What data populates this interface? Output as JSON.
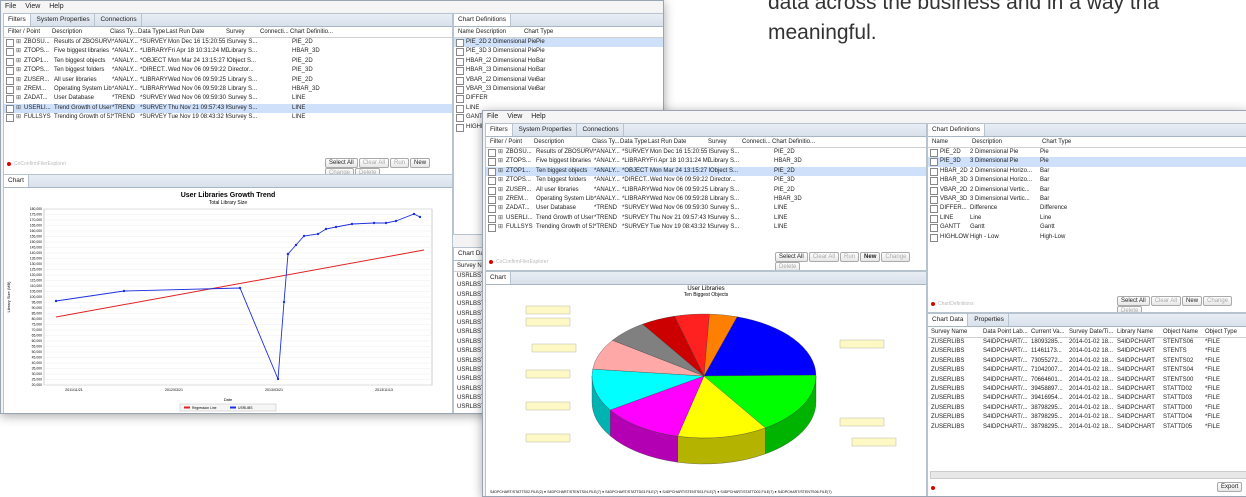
{
  "page_text": {
    "line1": "data across the business and in a way tha",
    "line2": "meaningful."
  },
  "colors": {
    "accent": "#3a6fc7",
    "selection": "#cfe0fa",
    "status_red": "#d00000"
  },
  "back_window": {
    "menu": [
      "File",
      "View",
      "Help"
    ],
    "tabs": [
      "Filters",
      "System Properties",
      "Connections"
    ],
    "columns": [
      "Filter / Point",
      "Description",
      "Class Ty...",
      "Data Type",
      "Last Run Date",
      "Survey",
      "Connecti...",
      "Chart Definitio..."
    ],
    "rows": [
      [
        "ZBOSU...",
        "Results of ZBOSURVEY (...",
        "*ANALY...",
        "*SURVEY",
        "Mon Dec 16 15:20:55 M...",
        "Survey S...",
        "",
        "PIE_2D"
      ],
      [
        "ZTOPS...",
        "Five biggest libraries",
        "*ANALY...",
        "*LIBRARY",
        "Fri Apr 18 10:31:24 MD...",
        "Library S...",
        "",
        "HBAR_3D"
      ],
      [
        "ZTOP1...",
        "Ten biggest objects",
        "*ANALY...",
        "*OBJECT",
        "Mon Mar 24 13:15:27 M...",
        "Object S...",
        "",
        "PIE_2D"
      ],
      [
        "ZTOPS...",
        "Ten biggest folders",
        "*ANALY...",
        "*DIRECT...",
        "Wed Nov 06 09:59:22 M...",
        "Director...",
        "",
        "PIE_3D"
      ],
      [
        "ZUSER...",
        "All user libraries",
        "*ANALY...",
        "*LIBRARY",
        "Wed Nov 06 09:59:25 M...",
        "Library S...",
        "",
        "PIE_2D"
      ],
      [
        "ZREM...",
        "Operating System Libra...",
        "*ANALY...",
        "*LIBRARY",
        "Wed Nov 06 09:59:28 M...",
        "Library S...",
        "",
        "HBAR_3D"
      ],
      [
        "ZADAT...",
        "User Database",
        "*TREND",
        "*SURVEY",
        "Wed Nov 06 09:59:30 M...",
        "Survey S...",
        "",
        "LINE"
      ],
      [
        "USERLI...",
        "Trend Growth of User Li...",
        "*TREND",
        "*SURVEY",
        "Thu Nov 21 09:57:43 M...",
        "Survey S...",
        "",
        "LINE"
      ],
      [
        "FULLSYS",
        "Trending Growth of 515...",
        "*TREND",
        "*SURVEY",
        "Tue Nov 19 08:43:32 M...",
        "Survey S...",
        "",
        "LINE"
      ]
    ],
    "selected_row": 7,
    "buttons": [
      "Select All",
      "Clear All",
      "Run",
      "New",
      "Change",
      "Delete"
    ],
    "status_text": "CoConfirmFilerExplorer",
    "chart_tab": "Chart",
    "chart_defs_tab": "Chart Definitions",
    "chart_defs_columns": [
      "Name",
      "Description",
      "Chart Type"
    ],
    "chart_defs_rows": [
      [
        "PIE_2D",
        "2 Dimensional Pie",
        "Pie"
      ],
      [
        "PIE_3D",
        "3 Dimensional Pie",
        "Pie"
      ],
      [
        "HBAR_2D",
        "2 Dimensional Horizo...",
        "Bar"
      ],
      [
        "HBAR_3D",
        "3 Dimensional Horizo...",
        "Bar"
      ],
      [
        "VBAR_2D",
        "2 Dimensional Vertic...",
        "Bar"
      ],
      [
        "VBAR_3D",
        "3 Dimensional Vertic...",
        "Bar"
      ],
      [
        "DIFFER...",
        "",
        ""
      ],
      [
        "LINE",
        "",
        ""
      ],
      [
        "GANTT",
        "",
        ""
      ],
      [
        "HIGHLO",
        "",
        ""
      ]
    ],
    "chart_data_tab": "Chart Dat",
    "chart_data_col": "Survey Nam",
    "chart_data_rows": [
      "USRLBSTR",
      "USRLBSTR",
      "USRLBSTR",
      "USRLBSTR",
      "USRLBSTR",
      "USRLBSTR",
      "USRLBSTR",
      "USRLBSTR",
      "USRLBSTR",
      "USRLBSTR",
      "USRLBSTR",
      "USRLBSTR",
      "USRLBSTR",
      "USRLBSTR",
      "USRLBSTR",
      "USRLBSTR"
    ],
    "line_chart": {
      "title": "User Libraries Growth Trend",
      "subtitle": "Total Library Size",
      "xlabel": "Date",
      "ylabel": "Library Size (MB)",
      "y_ticks": [
        "180,000",
        "175,000",
        "170,000",
        "165,000",
        "160,000",
        "155,000",
        "150,000",
        "145,000",
        "140,000",
        "135,000",
        "130,000",
        "125,000",
        "120,000",
        "115,000",
        "110,000",
        "105,000",
        "100,000",
        "95,000",
        "90,000",
        "85,000",
        "80,000",
        "75,000",
        "70,000",
        "65,000",
        "60,000",
        "55,000",
        "50,000",
        "45,000",
        "40,000",
        "35,000",
        "30,000",
        "25,000",
        "20,000"
      ],
      "x_ticks": [
        "2011/11/21",
        "2012/03/21",
        "2013/03/21",
        "2013/11/13"
      ],
      "legend": [
        "Regression Line",
        "USRLIBS"
      ]
    }
  },
  "front_window": {
    "menu": [
      "File",
      "View",
      "Help"
    ],
    "tabs": [
      "Filters",
      "System Properties",
      "Connections"
    ],
    "columns": [
      "Filter / Point",
      "Description",
      "Class Ty...",
      "Data Type",
      "Last Run Date",
      "Survey",
      "Connecti...",
      "Chart Definitio..."
    ],
    "rows": [
      [
        "ZBOSU...",
        "Results of ZBOSURVEY (...",
        "*ANALY...",
        "*SURVEY",
        "Mon Dec 16 15:20:55 M...",
        "Survey S...",
        "",
        "PIE_2D"
      ],
      [
        "ZTOPS...",
        "Five biggest libraries",
        "*ANALY...",
        "*LIBRARY",
        "Fri Apr 18 10:31:24 MD...",
        "Library S...",
        "",
        "HBAR_3D"
      ],
      [
        "ZTOP1...",
        "Ten biggest objects",
        "*ANALY...",
        "*OBJECT",
        "Mon Mar 24 13:15:27 M...",
        "Object S...",
        "",
        "PIE_2D"
      ],
      [
        "ZTOPS...",
        "Ten biggest folders",
        "*ANALY...",
        "*DIRECT...",
        "Wed Nov 06 09:59:22 M...",
        "Director...",
        "",
        "PIE_3D"
      ],
      [
        "ZUSER...",
        "All user libraries",
        "*ANALY...",
        "*LIBRARY",
        "Wed Nov 06 09:59:25 M...",
        "Library S...",
        "",
        "PIE_2D"
      ],
      [
        "ZREM...",
        "Operating System Libra...",
        "*ANALY...",
        "*LIBRARY",
        "Wed Nov 06 09:59:28 M...",
        "Library S...",
        "",
        "HBAR_3D"
      ],
      [
        "ZADAT...",
        "User Database",
        "*TREND",
        "*SURVEY",
        "Wed Nov 06 09:59:30 M...",
        "Survey S...",
        "",
        "LINE"
      ],
      [
        "USERLI...",
        "Trend Growth of User Li...",
        "*TREND",
        "*SURVEY",
        "Thu Nov 21 09:57:43 M...",
        "Survey S...",
        "",
        "LINE"
      ],
      [
        "FULLSYS",
        "Trending Growth of 515...",
        "*TREND",
        "*SURVEY",
        "Tue Nov 19 08:43:32 M...",
        "Survey S...",
        "",
        "LINE"
      ]
    ],
    "selected_row": 2,
    "buttons": [
      "Select All",
      "Clear All",
      "Run",
      "New",
      "Change",
      "Delete"
    ],
    "status_text": "CoConfirmFilerExplorer",
    "chart_tab": "Chart",
    "pie_chart": {
      "title": "User Libraries",
      "subtitle": "Ten Biggest Objects",
      "slices": [
        {
          "color": "#0000ff",
          "value": 20
        },
        {
          "color": "#00ff00",
          "value": 16
        },
        {
          "color": "#ffff00",
          "value": 13
        },
        {
          "color": "#ff00ff",
          "value": 12
        },
        {
          "color": "#00ffff",
          "value": 11
        },
        {
          "color": "#ffa8a8",
          "value": 8
        },
        {
          "color": "#808080",
          "value": 6
        },
        {
          "color": "#cc0000",
          "value": 5
        },
        {
          "color": "#ff2020",
          "value": 5
        },
        {
          "color": "#ff8000",
          "value": 4
        }
      ],
      "legend_text": "S4DPCHART/STATTS02.FILE(2) ● S4DPCHART/STENTS04.FILE(7) ● S4DPCHART/STATTD03.FILE(7) ● S4DPCHART/STENTS03.FILE(7) ● S4DPCHART/STATTD02.FILE(7) ● S4DPCHART/STENTS06.FILE(7)"
    },
    "chart_defs": {
      "tab": "Chart Definitions",
      "columns": [
        "Name",
        "Description",
        "Chart Type"
      ],
      "rows": [
        [
          "PIE_2D",
          "2 Dimensional Pie",
          "Pie"
        ],
        [
          "PIE_3D",
          "3 Dimensional Pie",
          "Pie"
        ],
        [
          "HBAR_2D",
          "2 Dimensional Horizo...",
          "Bar"
        ],
        [
          "HBAR_3D",
          "3 Dimensional Horizo...",
          "Bar"
        ],
        [
          "VBAR_2D",
          "2 Dimensional Vertic...",
          "Bar"
        ],
        [
          "VBAR_3D",
          "3 Dimensional Vertic...",
          "Bar"
        ],
        [
          "DIFFER...",
          "Difference",
          "Difference"
        ],
        [
          "LINE",
          "Line",
          "Line"
        ],
        [
          "GANTT",
          "Gantt",
          "Gantt"
        ],
        [
          "HIGHLOW",
          "High - Low",
          "High-Low"
        ]
      ],
      "selected_row": 1,
      "buttons": [
        "Select All",
        "Clear All",
        "New",
        "Change",
        "Delete"
      ],
      "status_text": "ChartDefinitions"
    },
    "chart_data": {
      "tabs": [
        "Chart Data",
        "Properties"
      ],
      "columns": [
        "Survey Name",
        "Data Point Lab...",
        "Current Va...",
        "Survey Date/Ti...",
        "Library Name",
        "Object Name",
        "Object Type"
      ],
      "rows": [
        [
          "ZUSERLIBS",
          "S4IDPCHART/...",
          "18093285...",
          "2014-01-02 18...",
          "S4IDPCHART",
          "STENTS06",
          "*FILE"
        ],
        [
          "ZUSERLIBS",
          "S4IDPCHART/...",
          "11461173...",
          "2014-01-02 18...",
          "S4IDPCHART",
          "STENTS",
          "*FILE"
        ],
        [
          "ZUSERLIBS",
          "S4IDPCHART/...",
          "73055272...",
          "2014-01-02 18...",
          "S4IDPCHART",
          "STENTS02",
          "*FILE"
        ],
        [
          "ZUSERLIBS",
          "S4IDPCHART/...",
          "71042007...",
          "2014-01-02 18...",
          "S4IDPCHART",
          "STENTS04",
          "*FILE"
        ],
        [
          "ZUSERLIBS",
          "S4IDPCHART/...",
          "70664601...",
          "2014-01-02 18...",
          "S4IDPCHART",
          "STENTS00",
          "*FILE"
        ],
        [
          "ZUSERLIBS",
          "S4IDPCHART/...",
          "39458897...",
          "2014-01-02 18...",
          "S4IDPCHART",
          "STATTD02",
          "*FILE"
        ],
        [
          "ZUSERLIBS",
          "S4IDPCHART/...",
          "39416954...",
          "2014-01-02 18...",
          "S4IDPCHART",
          "STATTD03",
          "*FILE"
        ],
        [
          "ZUSERLIBS",
          "S4IDPCHART/...",
          "38798295...",
          "2014-01-02 18...",
          "S4IDPCHART",
          "STATTD00",
          "*FILE"
        ],
        [
          "ZUSERLIBS",
          "S4IDPCHART/...",
          "38798295...",
          "2014-01-02 18...",
          "S4IDPCHART",
          "STATTD04",
          "*FILE"
        ],
        [
          "ZUSERLIBS",
          "S4IDPCHART/...",
          "38798295...",
          "2014-01-02 18...",
          "S4IDPCHART",
          "STATTD05",
          "*FILE"
        ]
      ],
      "export_button": "Export"
    }
  }
}
